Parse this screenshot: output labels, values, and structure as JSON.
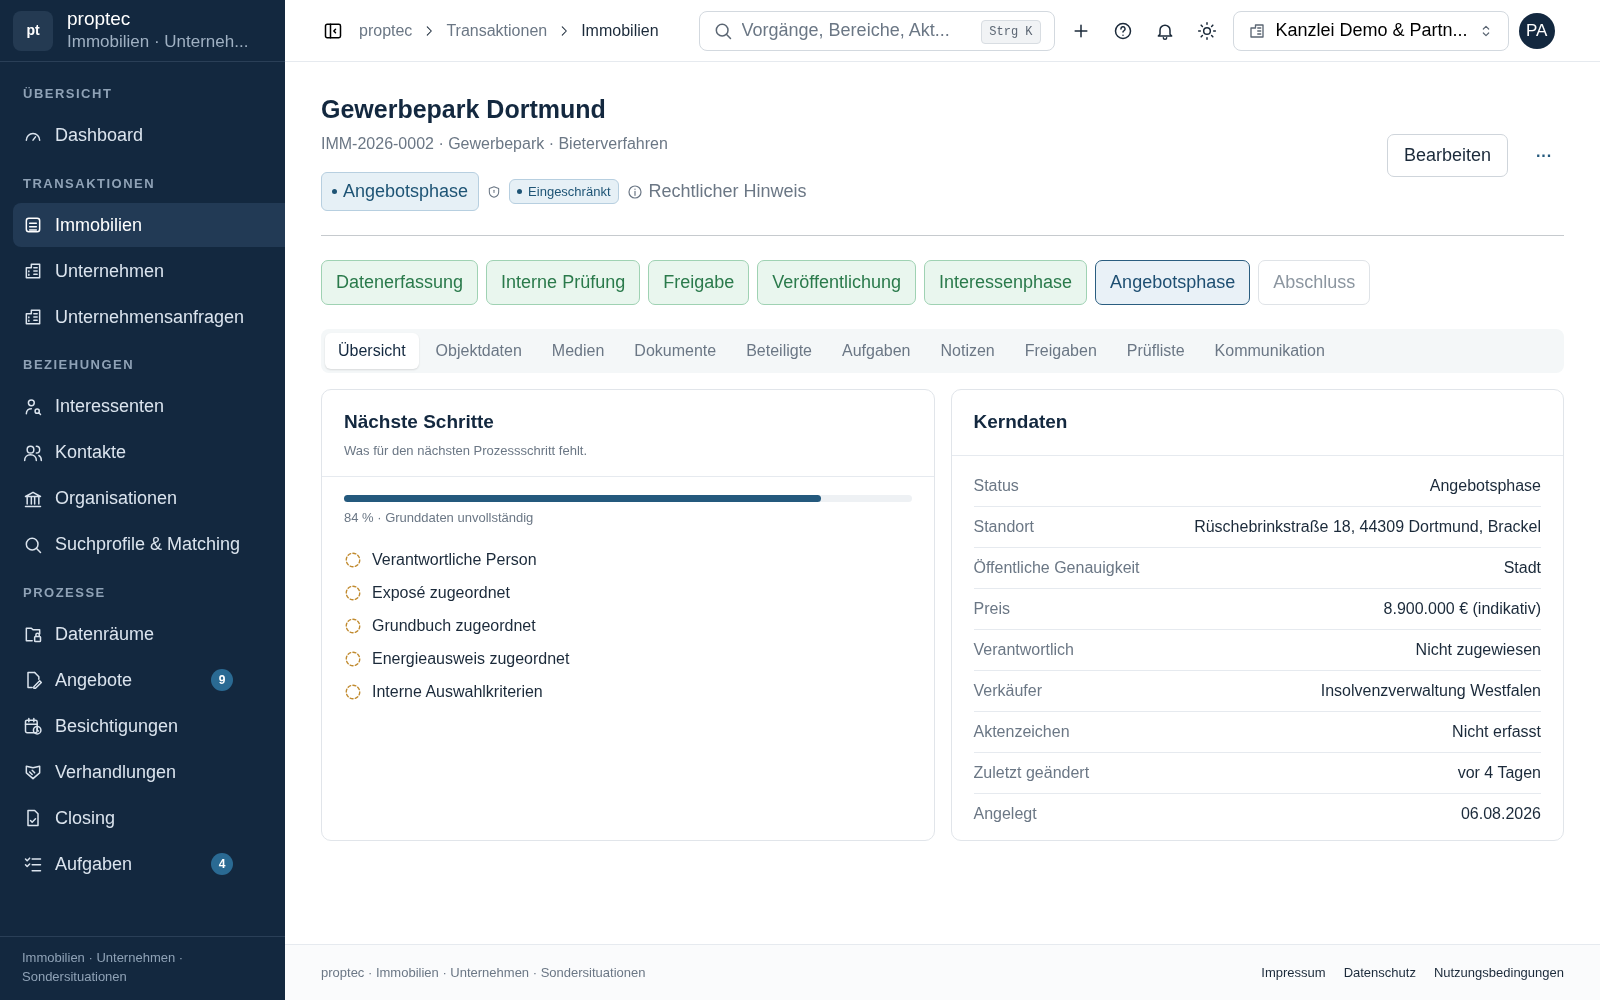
{
  "sidebar": {
    "brand": {
      "logo": "pt",
      "name": "proptec",
      "subtitle": "Immobilien · Unterneh..."
    },
    "sections": [
      {
        "title": "ÜBERSICHT",
        "items": [
          {
            "label": "Dashboard",
            "selected": false
          }
        ]
      },
      {
        "title": "TRANSAKTIONEN",
        "items": [
          {
            "label": "Immobilien",
            "selected": true
          },
          {
            "label": "Unternehmen",
            "selected": false
          },
          {
            "label": "Unternehmensanfragen",
            "selected": false
          }
        ]
      },
      {
        "title": "BEZIEHUNGEN",
        "items": [
          {
            "label": "Interessenten",
            "selected": false
          },
          {
            "label": "Kontakte",
            "selected": false
          },
          {
            "label": "Organisationen",
            "selected": false
          },
          {
            "label": "Suchprofile & Matching",
            "selected": false
          }
        ]
      },
      {
        "title": "PROZESSE",
        "items": [
          {
            "label": "Datenräume",
            "selected": false
          },
          {
            "label": "Angebote",
            "selected": false,
            "count": "9"
          },
          {
            "label": "Besichtigungen",
            "selected": false
          },
          {
            "label": "Verhandlungen",
            "selected": false
          },
          {
            "label": "Closing",
            "selected": false
          },
          {
            "label": "Aufgaben",
            "selected": false,
            "count": "4"
          }
        ]
      }
    ],
    "footer": "Immobilien · Unternehmen · Sondersituationen"
  },
  "header": {
    "breadcrumb": [
      "proptec",
      "Transaktionen",
      "Immobilien"
    ],
    "search": {
      "placeholder": "Vorgänge, Bereiche, Akt...",
      "shortcut": "Strg K"
    },
    "workspace": "Kanzlei Demo & Partn...",
    "avatar": "PA"
  },
  "page": {
    "title": "Gewerbepark Dortmund",
    "subtitle": "IMM-2026-0002 · Gewerbepark · Bieterverfahren",
    "status": "Angebotsphase",
    "visibility": "Eingeschränkt",
    "legal_note": "Rechtlicher Hinweis",
    "edit_button": "Bearbeiten",
    "more_button": "···"
  },
  "stages": [
    {
      "label": "Datenerfassung",
      "kind": "done"
    },
    {
      "label": "Interne Prüfung",
      "kind": "done"
    },
    {
      "label": "Freigabe",
      "kind": "done"
    },
    {
      "label": "Veröffentlichung",
      "kind": "done"
    },
    {
      "label": "Interessenphase",
      "kind": "done"
    },
    {
      "label": "Angebotsphase",
      "kind": "current"
    },
    {
      "label": "Abschluss",
      "kind": "pending"
    }
  ],
  "tabs": [
    {
      "label": "Übersicht",
      "selected": true
    },
    {
      "label": "Objektdaten",
      "selected": false
    },
    {
      "label": "Medien",
      "selected": false
    },
    {
      "label": "Dokumente",
      "selected": false
    },
    {
      "label": "Beteiligte",
      "selected": false
    },
    {
      "label": "Aufgaben",
      "selected": false
    },
    {
      "label": "Notizen",
      "selected": false
    },
    {
      "label": "Freigaben",
      "selected": false
    },
    {
      "label": "Prüfliste",
      "selected": false
    },
    {
      "label": "Kommunikation",
      "selected": false
    }
  ],
  "next_steps": {
    "title": "Nächste Schritte",
    "subtitle": "Was für den nächsten Prozessschritt fehlt.",
    "level": 0.84,
    "progress_text": "84 % · Grunddaten unvollständig",
    "items": [
      {
        "label": "Verantwortliche Person",
        "checked": false
      },
      {
        "label": "Exposé zugeordnet",
        "checked": false
      },
      {
        "label": "Grundbuch zugeordnet",
        "checked": false
      },
      {
        "label": "Energieausweis zugeordnet",
        "checked": false
      },
      {
        "label": "Interne Auswahlkriterien",
        "checked": false
      }
    ]
  },
  "key_data": {
    "title": "Kerndaten",
    "rows": [
      {
        "label": "Status",
        "value": "Angebotsphase"
      },
      {
        "label": "Standort",
        "value": "Rüschebrinkstraße 18, 44309 Dortmund, Brackel"
      },
      {
        "label": "Öffentliche Genauigkeit",
        "value": "Stadt"
      },
      {
        "label": "Preis",
        "value": "8.900.000 € (indikativ)"
      },
      {
        "label": "Verantwortlich",
        "value": "Nicht zugewiesen"
      },
      {
        "label": "Verkäufer",
        "value": "Insolvenzverwaltung Westfalen"
      },
      {
        "label": "Aktenzeichen",
        "value": "Nicht erfasst"
      },
      {
        "label": "Zuletzt geändert",
        "value": "vor 4 Tagen"
      },
      {
        "label": "Angelegt",
        "value": "06.08.2026"
      }
    ]
  },
  "footer": {
    "text": "proptec · Immobilien · Unternehmen · Sondersituationen",
    "links": [
      "Impressum",
      "Datenschutz",
      "Nutzungsbedingungen"
    ]
  }
}
